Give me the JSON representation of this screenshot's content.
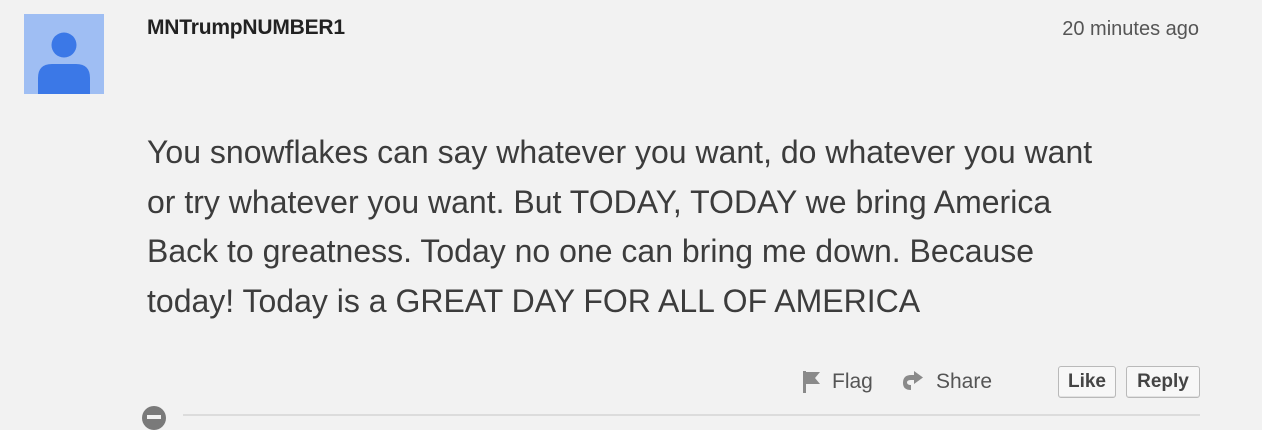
{
  "comment": {
    "author": "MNTrumpNUMBER1",
    "timestamp": "20 minutes ago",
    "body": "You snowflakes can say whatever you want, do whatever you want\nor try whatever you want.  But TODAY, TODAY we bring America\nBack to greatness.  Today no one can bring me down.  Because\ntoday!  Today is a GREAT DAY FOR ALL OF AMERICA",
    "avatar": {
      "icon": "default-user-icon",
      "background": "#9fbef3",
      "foreground": "#3b78e7"
    }
  },
  "actions": {
    "flag_label": "Flag",
    "flag_icon": "flag-icon",
    "share_label": "Share",
    "share_icon": "share-icon",
    "like_label": "Like",
    "reply_label": "Reply"
  },
  "next_comment": {
    "avatar_icon": "default-user-icon"
  }
}
